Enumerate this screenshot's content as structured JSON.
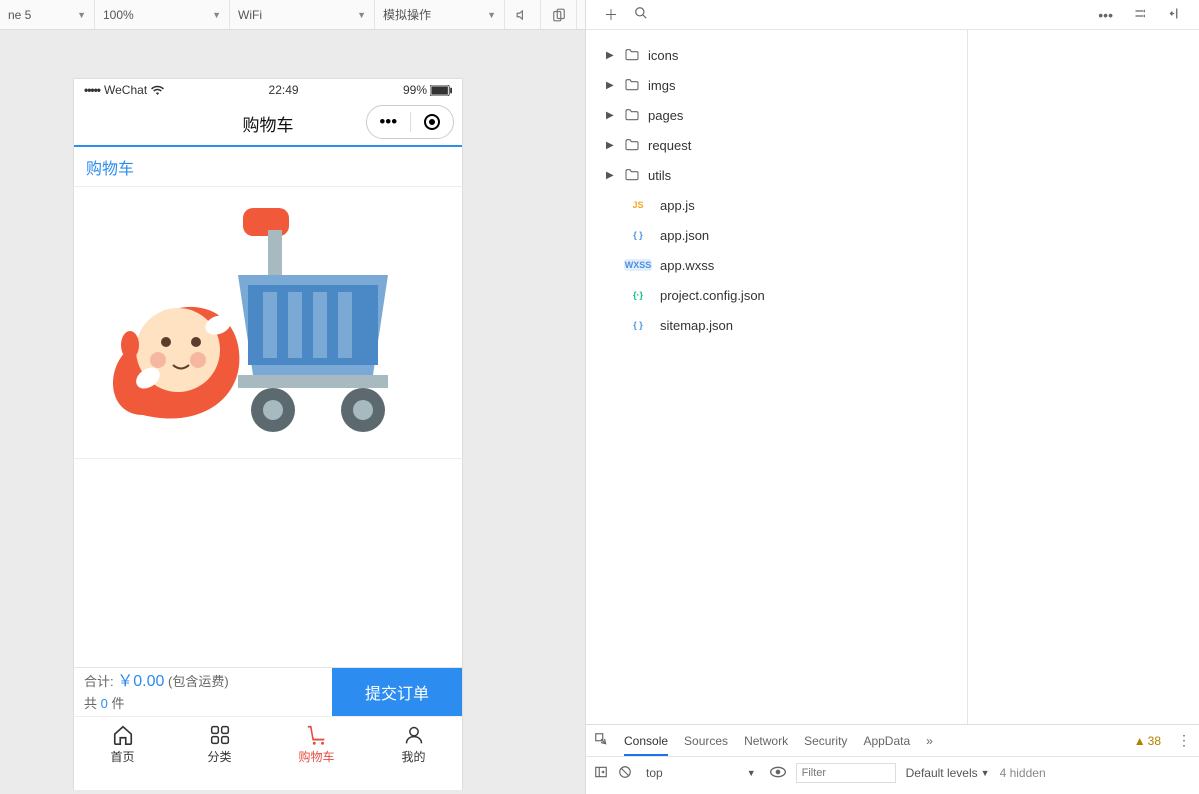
{
  "toolbar": {
    "device": "ne 5",
    "zoom": "100%",
    "network": "WiFi",
    "simulate": "模拟操作"
  },
  "simulator": {
    "statusbar": {
      "carrier": "WeChat",
      "time": "22:49",
      "battery": "99%"
    },
    "header": {
      "title": "购物车"
    },
    "cart": {
      "section_title": "购物车",
      "summary": {
        "total_label": "合计:",
        "currency": "￥",
        "amount": "0.00",
        "shipping_note": "(包含运费)",
        "count_prefix": "共",
        "count": "0",
        "count_suffix": "件"
      },
      "submit": "提交订单"
    },
    "tabbar": [
      {
        "label": "首页"
      },
      {
        "label": "分类"
      },
      {
        "label": "购物车"
      },
      {
        "label": "我的"
      }
    ]
  },
  "tree": {
    "folders": [
      "icons",
      "imgs",
      "pages",
      "request",
      "utils"
    ],
    "files": [
      {
        "badge": "JS",
        "name": "app.js",
        "cls": "badge-js"
      },
      {
        "badge": "{ }",
        "name": "app.json",
        "cls": "badge-json"
      },
      {
        "badge": "WXSS",
        "name": "app.wxss",
        "cls": "badge-wxss"
      },
      {
        "badge": "{·}",
        "name": "project.config.json",
        "cls": "badge-config"
      },
      {
        "badge": "{ }",
        "name": "sitemap.json",
        "cls": "badge-json"
      }
    ]
  },
  "console": {
    "tabs": [
      "Console",
      "Sources",
      "Network",
      "Security",
      "AppData"
    ],
    "warn_count": "38",
    "context": "top",
    "filter_placeholder": "Filter",
    "levels": "Default levels",
    "hidden": "4 hidden"
  }
}
